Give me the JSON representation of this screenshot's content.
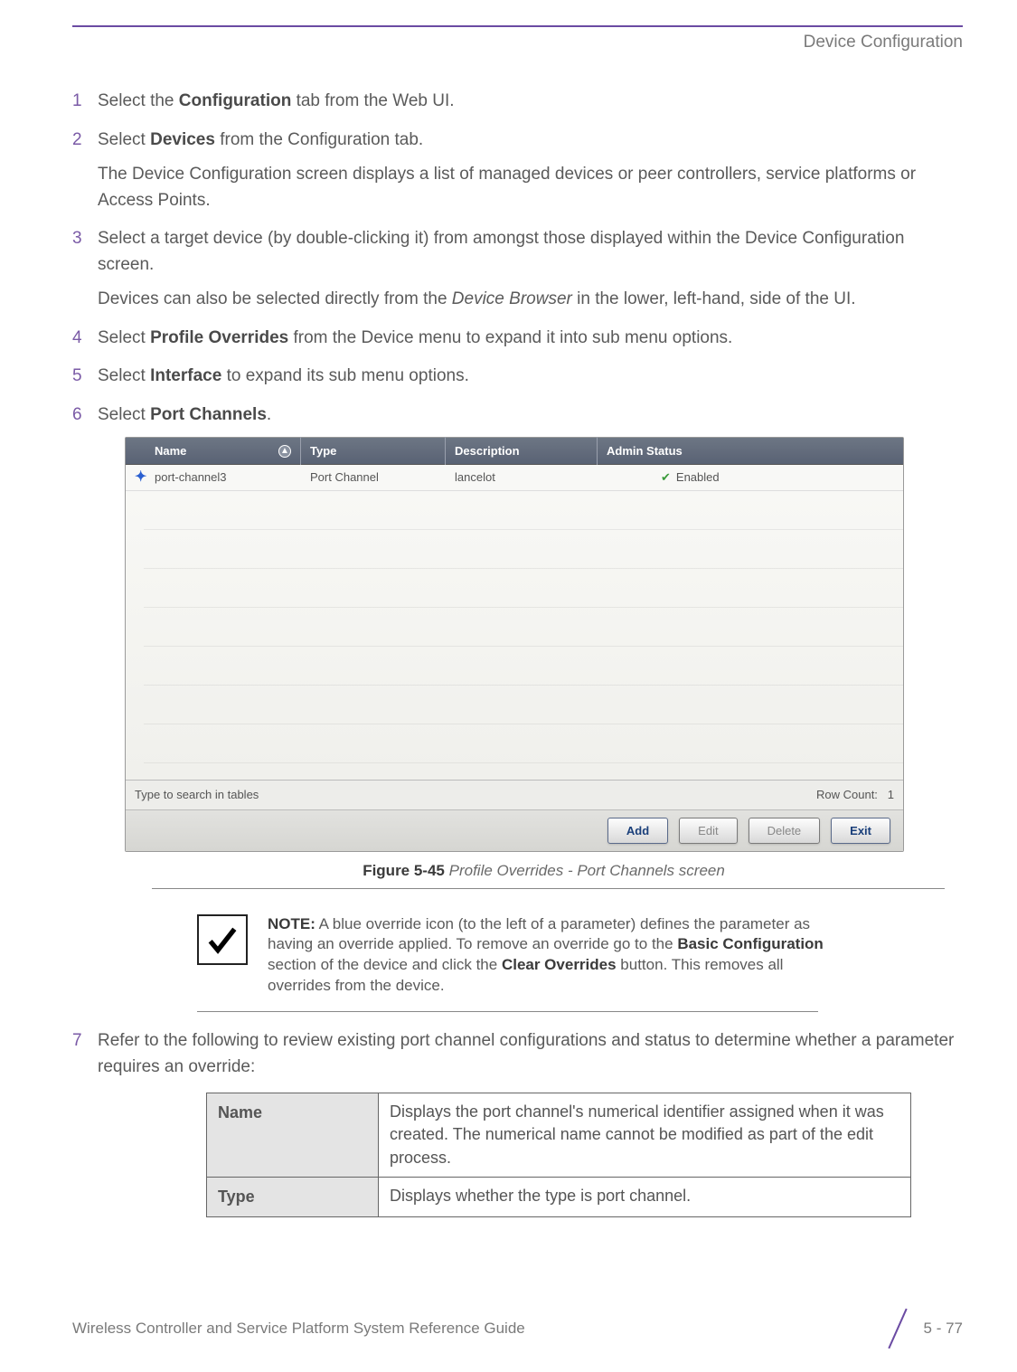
{
  "header": {
    "section": "Device Configuration"
  },
  "steps": {
    "s1": {
      "text_a": "Select the ",
      "bold": "Configuration",
      "text_b": " tab from the Web UI."
    },
    "s2": {
      "text_a": "Select ",
      "bold": "Devices",
      "text_b": " from the Configuration tab.",
      "sub": "The Device Configuration screen displays a list of managed devices or peer controllers, service platforms or Access Points."
    },
    "s3": {
      "text": "Select a target device (by double-clicking it) from amongst those displayed within the Device Configuration screen.",
      "sub_a": "Devices can also be selected directly from the ",
      "sub_i": "Device Browser",
      "sub_b": " in the lower, left-hand, side of the UI."
    },
    "s4": {
      "text_a": "Select ",
      "bold": "Profile Overrides",
      "text_b": " from the Device menu to expand it into sub menu options."
    },
    "s5": {
      "text_a": "Select ",
      "bold": "Interface",
      "text_b": " to expand its sub menu options."
    },
    "s6": {
      "text_a": "Select ",
      "bold": "Port Channels",
      "text_b": "."
    },
    "s7": {
      "text": "Refer to the following to review existing port channel configurations and status to determine whether a parameter requires an override:"
    }
  },
  "chart_data": {
    "type": "table",
    "columns": [
      "Name",
      "Type",
      "Description",
      "Admin Status"
    ],
    "rows": [
      {
        "name": "port-channel3",
        "type": "Port Channel",
        "description": "lancelot",
        "admin_status": "Enabled",
        "override_marker": true,
        "status_ok": true
      }
    ],
    "search_placeholder": "Type to search in tables",
    "row_count_label": "Row Count:",
    "row_count_value": "1",
    "buttons": {
      "add": "Add",
      "edit": "Edit",
      "delete": "Delete",
      "exit": "Exit"
    }
  },
  "figure": {
    "label": "Figure 5-45",
    "caption": "Profile Overrides - Port Channels screen"
  },
  "note": {
    "label": "NOTE:",
    "t1": " A blue override icon (to the left of a parameter) defines the parameter as having an override applied. To remove an override go to the ",
    "b1": "Basic Configuration",
    "t2": " section of the device and click the ",
    "b2": "Clear Overrides",
    "t3": " button. This removes all overrides from the device."
  },
  "defs": {
    "name_label": "Name",
    "name_desc": "Displays the port channel's numerical identifier assigned when it was created. The numerical name cannot be modified as part of the edit process.",
    "type_label": "Type",
    "type_desc": "Displays whether the type is port channel."
  },
  "footer": {
    "left": "Wireless Controller and Service Platform System Reference Guide",
    "right": "5 - 77"
  }
}
